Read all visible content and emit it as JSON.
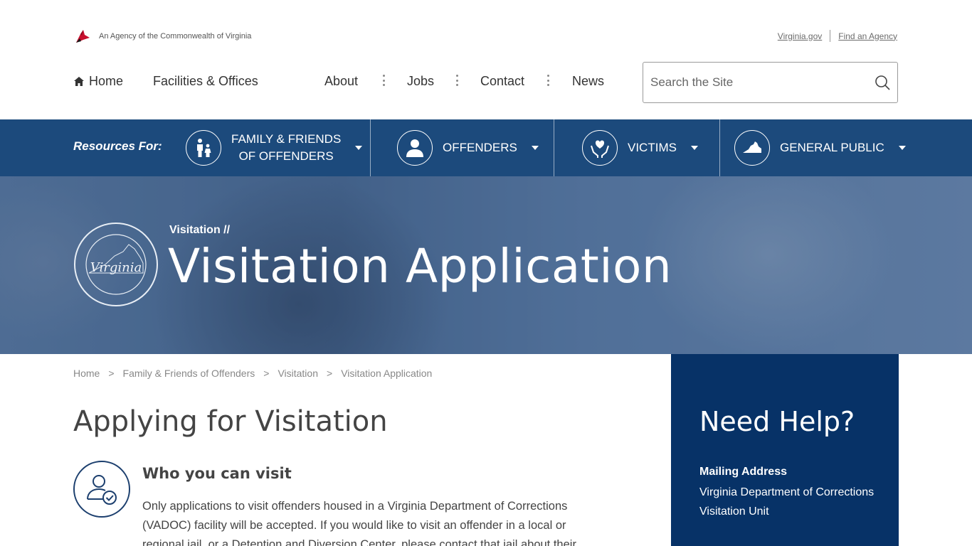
{
  "header": {
    "agency_text": "An Agency of the Commonwealth of Virginia",
    "util_links": [
      "Virginia.gov",
      "Find an Agency"
    ]
  },
  "nav": {
    "home": "Home",
    "facilities": "Facilities & Offices",
    "about": "About",
    "jobs": "Jobs",
    "contact": "Contact",
    "news": "News"
  },
  "search": {
    "placeholder": "Search the Site"
  },
  "resources": {
    "label": "Resources For:",
    "items": [
      {
        "line1": "Family & Friends",
        "line2": "of Offenders",
        "icon": "family-icon"
      },
      {
        "line1": "Offenders",
        "icon": "person-icon"
      },
      {
        "line1": "Victims",
        "icon": "heart-hands-icon"
      },
      {
        "line1": "General Public",
        "icon": "virginia-state-icon"
      }
    ]
  },
  "hero": {
    "parent": "Visitation //",
    "title": "Visitation Application",
    "seal_text": "Virginia"
  },
  "breadcrumb": [
    "Home",
    "Family & Friends of Offenders",
    "Visitation",
    "Visitation Application"
  ],
  "breadcrumb_sep": ">",
  "content": {
    "title": "Applying for Visitation",
    "section_title": "Who you can visit",
    "section_body": "Only applications to visit offenders housed in a Virginia Department of Corrections (VADOC) facility will be accepted. If you would like to visit an offender in a local or regional jail, or a Detention and Diversion Center, please contact that jail about their"
  },
  "help": {
    "title": "Need Help?",
    "mail_label": "Mailing Address",
    "address_lines": [
      "Virginia Department of Corrections",
      "Visitation Unit"
    ]
  },
  "colors": {
    "nav_blue": "#1c4a7c",
    "help_blue": "#073267",
    "cardinal_red": "#c8102e"
  }
}
